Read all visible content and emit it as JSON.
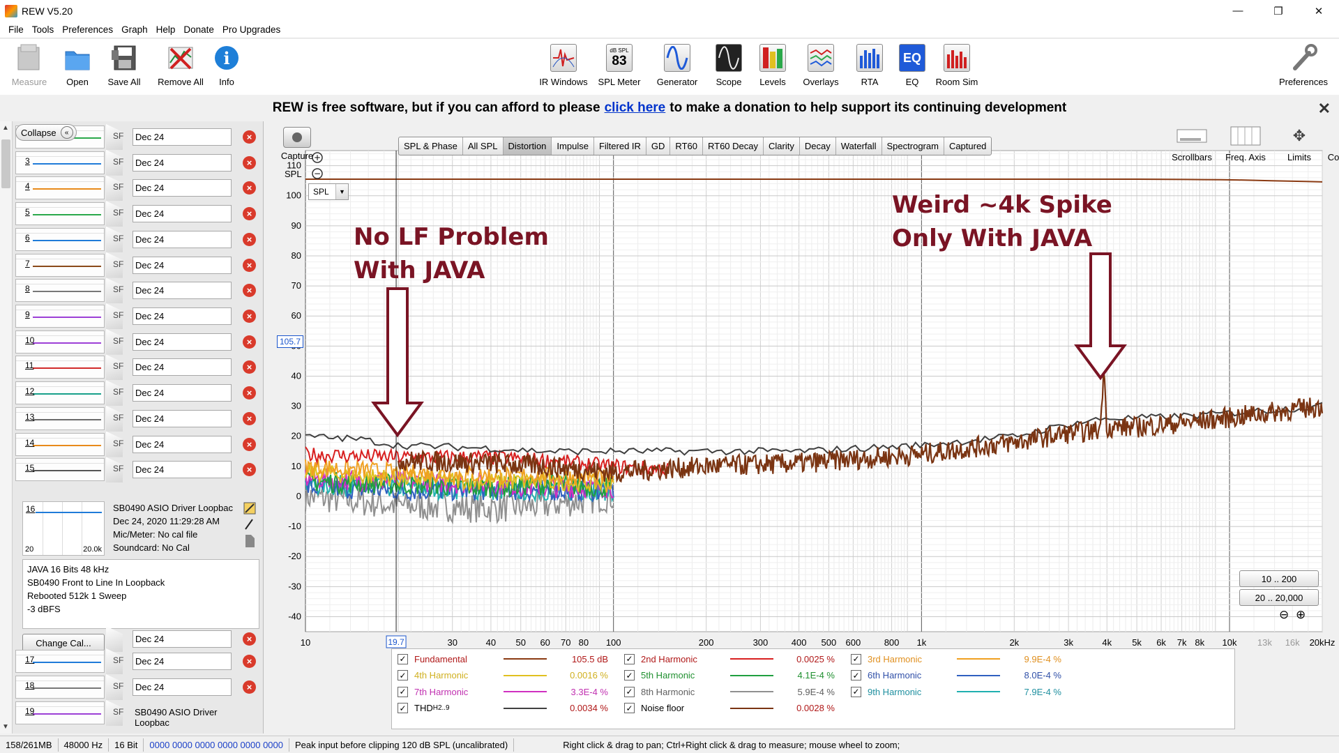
{
  "window": {
    "title": "REW V5.20",
    "min": "—",
    "max": "❐",
    "close": "✕"
  },
  "menu": [
    "File",
    "Tools",
    "Preferences",
    "Graph",
    "Help",
    "Donate",
    "Pro Upgrades"
  ],
  "toolbar": {
    "left": [
      {
        "label": "Measure",
        "icon": "measure-icon",
        "enabled": false
      },
      {
        "label": "Open",
        "icon": "folder-icon",
        "enabled": true
      },
      {
        "label": "Save All",
        "icon": "save-icon",
        "enabled": true
      },
      {
        "label": "Remove All",
        "icon": "remove-icon",
        "enabled": true
      },
      {
        "label": "Info",
        "icon": "info-icon",
        "enabled": true
      }
    ],
    "center": [
      {
        "label": "IR Windows",
        "icon": "ir-windows-icon"
      },
      {
        "label": "SPL Meter",
        "icon": "spl-meter-icon",
        "badge_top": "dB SPL",
        "badge_value": "83"
      },
      {
        "label": "Generator",
        "icon": "generator-icon"
      },
      {
        "label": "Scope",
        "icon": "scope-icon"
      },
      {
        "label": "Levels",
        "icon": "levels-icon"
      },
      {
        "label": "Overlays",
        "icon": "overlays-icon"
      },
      {
        "label": "RTA",
        "icon": "rta-icon"
      },
      {
        "label": "EQ",
        "icon": "eq-icon"
      },
      {
        "label": "Room Sim",
        "icon": "room-sim-icon"
      }
    ],
    "right": {
      "label": "Preferences",
      "icon": "wrench-icon"
    }
  },
  "banner": {
    "before": "REW is free software, but if you can afford to please",
    "link": "click here",
    "after": "to make a donation to help support its continuing development",
    "close": "✕"
  },
  "left_panel": {
    "collapse_label": "Collapse",
    "measurements": [
      {
        "num": "2",
        "name": "Dec 24",
        "color": "#2aa84a"
      },
      {
        "num": "3",
        "name": "Dec 24",
        "color": "#1f7bd8"
      },
      {
        "num": "4",
        "name": "Dec 24",
        "color": "#e88a1a"
      },
      {
        "num": "5",
        "name": "Dec 24",
        "color": "#2aa84a"
      },
      {
        "num": "6",
        "name": "Dec 24",
        "color": "#1f7bd8"
      },
      {
        "num": "7",
        "name": "Dec 24",
        "color": "#8a4a1a"
      },
      {
        "num": "8",
        "name": "Dec 24",
        "color": "#777777"
      },
      {
        "num": "9",
        "name": "Dec 24",
        "color": "#9c3fd6"
      },
      {
        "num": "10",
        "name": "Dec 24",
        "color": "#9c3fd6"
      },
      {
        "num": "11",
        "name": "Dec 24",
        "color": "#d12a2a"
      },
      {
        "num": "12",
        "name": "Dec 24",
        "color": "#18a08a"
      },
      {
        "num": "13",
        "name": "Dec 24",
        "color": "#6a6a6a"
      },
      {
        "num": "14",
        "name": "Dec 24",
        "color": "#e88a1a"
      },
      {
        "num": "15",
        "name": "Dec 24",
        "color": "#555555"
      }
    ],
    "selected": {
      "num": "16",
      "range_lo": "20",
      "range_hi": "20.0k",
      "line1": "SB0490 ASIO Driver Loopbac",
      "line2": "Dec 24, 2020 11:29:28 AM",
      "line3": "Mic/Meter: No cal file",
      "line4": "Soundcard: No Cal",
      "notes": [
        "JAVA 16 Bits 48 kHz",
        "SB0490 Front to Line In Loopback",
        "Rebooted 512k 1 Sweep",
        "-3 dBFS"
      ],
      "name": "Dec 24",
      "change_cal": "Change Cal..."
    },
    "after": [
      {
        "num": "17",
        "name": "Dec 24",
        "color": "#1f7bd8"
      },
      {
        "num": "18",
        "name": "Dec 24",
        "color": "#777777"
      },
      {
        "num": "19",
        "name": "SB0490 ASIO Driver Loopbac",
        "color": "#9c3fd6"
      }
    ],
    "spl_abbrev": "SF"
  },
  "graph": {
    "capture_label": "Capture",
    "spl_axis_label": "SPL",
    "tabs": [
      "SPL & Phase",
      "All SPL",
      "Distortion",
      "Impulse",
      "Filtered IR",
      "GD",
      "RT60",
      "RT60 Decay",
      "Clarity",
      "Decay",
      "Waterfall",
      "Spectrogram",
      "Captured"
    ],
    "active_tab": "Distortion",
    "controls": [
      {
        "label": "Scrollbars",
        "icon": "scrollbars-icon"
      },
      {
        "label": "Freq. Axis",
        "icon": "freq-axis-icon"
      },
      {
        "label": "Limits",
        "icon": "limits-icon"
      },
      {
        "label": "Controls",
        "icon": "gear-icon"
      }
    ],
    "spl_select": "SPL",
    "cursor_y": "105.7",
    "cursor_x": "19.7",
    "range_buttons": [
      "10 .. 200",
      "20 .. 20,000"
    ],
    "y_ticks": [
      "110",
      "100",
      "90",
      "80",
      "70",
      "60",
      "50",
      "40",
      "30",
      "20",
      "10",
      "0",
      "-10",
      "-20",
      "-30",
      "-40"
    ],
    "x_ticks": [
      "10",
      "30",
      "40",
      "50",
      "60",
      "70",
      "80",
      "100",
      "200",
      "300",
      "400",
      "500",
      "600",
      "800",
      "1k",
      "2k",
      "3k",
      "4k",
      "5k",
      "6k",
      "7k",
      "8k",
      "10k",
      "13k",
      "16k",
      "20kHz"
    ]
  },
  "chart_data": {
    "type": "line",
    "xscale": "log",
    "xlim": [
      10,
      20000
    ],
    "ylim": [
      -45,
      115
    ],
    "series": [
      {
        "name": "Fundamental",
        "color": "#8a3a12",
        "x": [
          10,
          100,
          1000,
          5000,
          10000,
          20000
        ],
        "y": [
          105.5,
          105.5,
          105.5,
          105.5,
          105.3,
          104.6
        ]
      },
      {
        "name": "THD H2..9",
        "color": "#404040",
        "x": [
          10,
          15,
          20,
          40,
          60,
          100,
          200,
          400,
          1000,
          2000,
          3000,
          4000,
          5000,
          8000,
          20000
        ],
        "y": [
          20,
          19,
          17,
          16,
          15,
          15,
          15,
          15,
          17,
          20,
          24,
          26,
          26,
          27,
          30
        ]
      },
      {
        "name": "Noise floor",
        "color": "#7a3412",
        "x": [
          20,
          40,
          60,
          100,
          200,
          400,
          1000,
          2000,
          3000,
          3800,
          3900,
          4000,
          5000,
          8000,
          20000
        ],
        "y": [
          12,
          11,
          10,
          8,
          10,
          11,
          14,
          18,
          21,
          22,
          42,
          23,
          23,
          25,
          30
        ]
      },
      {
        "name": "2nd Harmonic",
        "color": "#d81f1f",
        "x": [
          10,
          20,
          40,
          60,
          100,
          150
        ],
        "y": [
          14,
          13,
          13,
          12,
          10,
          9
        ]
      },
      {
        "name": "3rd Harmonic",
        "color": "#f0a020",
        "x": [
          10,
          20,
          40,
          60,
          100
        ],
        "y": [
          10,
          8,
          7,
          7,
          6
        ]
      },
      {
        "name": "4th Harmonic",
        "color": "#e0c020",
        "x": [
          10,
          20,
          40,
          60,
          100
        ],
        "y": [
          8,
          6,
          5,
          5,
          4
        ]
      },
      {
        "name": "5th Harmonic",
        "color": "#20a040",
        "x": [
          10,
          20,
          40,
          60,
          100
        ],
        "y": [
          5,
          4,
          3,
          4,
          3
        ]
      },
      {
        "name": "6th Harmonic",
        "color": "#3060c0",
        "x": [
          10,
          20,
          40,
          60,
          100
        ],
        "y": [
          3,
          2,
          2,
          2,
          2
        ]
      },
      {
        "name": "7th Harmonic",
        "color": "#d030c0",
        "x": [
          10,
          20,
          40,
          60,
          100
        ],
        "y": [
          6,
          5,
          4,
          3,
          3
        ]
      },
      {
        "name": "8th Harmonic",
        "color": "#909090",
        "x": [
          10,
          20,
          40,
          60,
          100
        ],
        "y": [
          0,
          -3,
          -4,
          -3,
          0
        ]
      },
      {
        "name": "9th Harmonic",
        "color": "#20b0b0",
        "x": [
          10,
          20,
          40,
          60,
          100
        ],
        "y": [
          4,
          3,
          2,
          2,
          2
        ]
      }
    ]
  },
  "annotations": {
    "left": [
      "No LF Problem",
      "With JAVA"
    ],
    "right": [
      "Weird ~4k Spike",
      "Only With JAVA"
    ]
  },
  "legend": [
    {
      "label": "Fundamental",
      "value": "105.5 dB",
      "color": "#8a3a12",
      "text_color": "#b01818"
    },
    {
      "label": "2nd Harmonic",
      "value": "0.0025 %",
      "color": "#d81f1f",
      "text_color": "#b01818"
    },
    {
      "label": "3rd Harmonic",
      "value": "9.9E-4 %",
      "color": "#f0a020",
      "text_color": "#e09020"
    },
    {
      "label": "4th Harmonic",
      "value": "0.0016 %",
      "color": "#e0c020",
      "text_color": "#d0b020"
    },
    {
      "label": "5th Harmonic",
      "value": "4.1E-4 %",
      "color": "#20a040",
      "text_color": "#209030"
    },
    {
      "label": "6th Harmonic",
      "value": "8.0E-4 %",
      "color": "#3060c0",
      "text_color": "#3050a8"
    },
    {
      "label": "7th Harmonic",
      "value": "3.3E-4 %",
      "color": "#d030c0",
      "text_color": "#c030b0"
    },
    {
      "label": "8th Harmonic",
      "value": "5.9E-4 %",
      "color": "#909090",
      "text_color": "#606060"
    },
    {
      "label": "9th Harmonic",
      "value": "7.9E-4 %",
      "color": "#20b0b0",
      "text_color": "#2090a0"
    },
    {
      "label": "THD",
      "label_sub": "H2..9",
      "value": "0.0034 %",
      "color": "#404040",
      "text_color": "#000000"
    },
    {
      "label": "Noise floor",
      "value": "0.0028 %",
      "color": "#7a3412",
      "text_color": "#000000"
    }
  ],
  "status": {
    "memory": "158/261MB",
    "rate": "48000 Hz",
    "bits": "16 Bit",
    "levels": "0000 0000  0000 0000  0000 0000",
    "peak": "Peak input before clipping 120 dB SPL (uncalibrated)",
    "hint": "Right click & drag to pan; Ctrl+Right click & drag to measure; mouse wheel to zoom;"
  }
}
